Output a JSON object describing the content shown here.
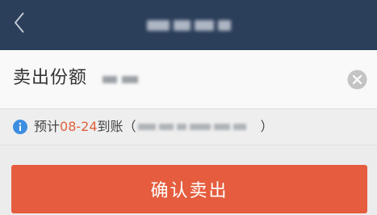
{
  "nav": {
    "back_icon": "chevron-left-icon",
    "title": ""
  },
  "sell": {
    "label": "卖出份额",
    "value": "",
    "clear_icon": "clear-circle-icon"
  },
  "info": {
    "icon": "info-icon",
    "prefix": "预计",
    "date": "08-24",
    "suffix": "到账（",
    "detail": "",
    "close_paren": "）"
  },
  "confirm_button": {
    "label": "确认卖出"
  },
  "colors": {
    "nav_bg": "#2b3e5a",
    "accent": "#e55d3e",
    "date_highlight": "#e0603c",
    "info_icon": "#3d8ee0"
  }
}
